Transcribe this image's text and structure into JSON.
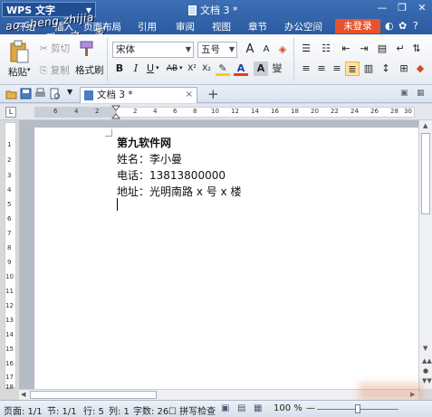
{
  "app": {
    "name": "WPS 文字",
    "document_title": "文档 3 *"
  },
  "watermark": {
    "line1": "ao cheng zhijia",
    "line2": "教 程 之 家"
  },
  "menu": {
    "items": [
      "开始",
      "插入",
      "页面布局",
      "引用",
      "审阅",
      "视图",
      "章节",
      "办公空间"
    ],
    "login": "未登录"
  },
  "ribbon": {
    "paste": "粘贴",
    "cut": "剪切",
    "copy": "复制",
    "format_painter": "格式刷",
    "font": "宋体",
    "size": "五号",
    "bold": "B",
    "italic": "I",
    "underline": "U",
    "strike": "AB",
    "superscript": "X²",
    "subscript": "X₂",
    "grow_font": "A",
    "shrink_font": "A"
  },
  "tabs": {
    "doc_tab": "文档 3 *",
    "close": "×",
    "new": "+"
  },
  "ruler": {
    "labels": [
      "6",
      "4",
      "2",
      "2",
      "4",
      "6",
      "8",
      "10",
      "12",
      "14",
      "16",
      "18",
      "20",
      "22",
      "24",
      "26",
      "28",
      "30"
    ],
    "vlabels": [
      "1",
      "2",
      "3",
      "4",
      "5",
      "6",
      "7",
      "8",
      "9",
      "10",
      "11",
      "12",
      "13",
      "14",
      "15",
      "16",
      "17",
      "18"
    ]
  },
  "document": {
    "lines": [
      "第九软件网",
      "姓名：李小曼",
      "电话：13813800000",
      "地址：光明南路 x 号 x 楼"
    ]
  },
  "status": {
    "page": "页面: 1/1",
    "section": "节: 1/1",
    "row": "行: 5",
    "col": "列: 1",
    "word_count": "字数: 26",
    "spell_check": "拼写检查",
    "zoom": "100 %"
  },
  "colors": {
    "title_bar": "#2c5aa0",
    "login_button": "#e8532d",
    "highlight_active": "#ffe39a"
  }
}
